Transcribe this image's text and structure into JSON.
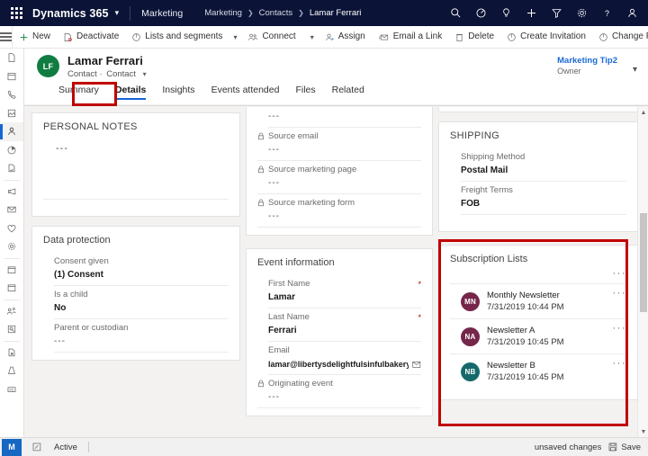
{
  "topbar": {
    "waffle_icon": "waffle-grid-icon",
    "brand": "Dynamics 365",
    "brand_chevron": "chevron-down-icon",
    "app_name": "Marketing",
    "breadcrumbs": [
      {
        "label": "Marketing"
      },
      {
        "label": "Contacts"
      },
      {
        "label": "Lamar Ferrari"
      }
    ],
    "icons": [
      {
        "name": "search-icon"
      },
      {
        "name": "gauge-icon"
      },
      {
        "name": "lightbulb-icon"
      },
      {
        "name": "plus-icon"
      },
      {
        "name": "filter-icon"
      },
      {
        "name": "gear-icon"
      },
      {
        "name": "question-icon"
      },
      {
        "name": "person-icon"
      }
    ]
  },
  "commandbar": {
    "menu_icon": "hamburger-icon",
    "items": [
      {
        "label": "New",
        "icon": "plus-icon"
      },
      {
        "label": "Deactivate",
        "icon": "deactivate-icon"
      },
      {
        "label": "Lists and segments",
        "icon": "lists-icon",
        "chevron": true
      },
      {
        "label": "Connect",
        "icon": "connect-icon",
        "chevron": true,
        "divider_before_chevron": true
      },
      {
        "label": "Assign",
        "icon": "assign-icon"
      },
      {
        "label": "Email a Link",
        "icon": "email-link-icon"
      },
      {
        "label": "Delete",
        "icon": "delete-icon"
      },
      {
        "label": "Create Invitation",
        "icon": "invitation-icon"
      },
      {
        "label": "Change Password",
        "icon": "password-icon"
      }
    ],
    "overflow": "…"
  },
  "rail": {
    "items": [
      {
        "name": "recent-icon"
      },
      {
        "name": "calendar-icon"
      },
      {
        "name": "phone-icon"
      },
      {
        "name": "activity-icon"
      },
      {
        "name": "contacts-icon",
        "selected": true
      },
      {
        "name": "segments-icon"
      },
      {
        "name": "subscription-lists-icon"
      },
      {
        "name": "campaign-icon"
      },
      {
        "name": "email-icon"
      },
      {
        "name": "heart-icon"
      },
      {
        "name": "settings-icon"
      },
      {
        "name": "events-icon"
      },
      {
        "name": "calendar2-icon"
      },
      {
        "name": "social-icon"
      },
      {
        "name": "lead-icon"
      },
      {
        "name": "form-icon"
      },
      {
        "name": "page-icon"
      },
      {
        "name": "keyword-icon"
      }
    ],
    "bottom_badge": "M"
  },
  "record_header": {
    "avatar_initials": "LF",
    "title": "Lamar Ferrari",
    "subtitle_type": "Contact",
    "subtitle_sep": "·",
    "subtitle_entity": "Contact",
    "subtitle_chevron": "chevron-down-icon",
    "owner_name": "Marketing Tip2",
    "owner_label": "Owner",
    "owner_chevron": "chevron-down-icon"
  },
  "tabs": [
    {
      "label": "Summary",
      "active": false
    },
    {
      "label": "Details",
      "active": true
    },
    {
      "label": "Insights",
      "active": false
    },
    {
      "label": "Events attended",
      "active": false
    },
    {
      "label": "Files",
      "active": false
    },
    {
      "label": "Related",
      "active": false
    }
  ],
  "column1": {
    "personal_notes": {
      "title": "PERSONAL NOTES",
      "value": "---"
    },
    "data_protection": {
      "title": "Data protection",
      "fields": [
        {
          "label": "Consent given",
          "value": "(1) Consent"
        },
        {
          "label": "Is a child",
          "value": "No"
        },
        {
          "label": "Parent or custodian",
          "value": "---"
        }
      ]
    }
  },
  "column2": {
    "source_card": {
      "top_value": "---",
      "fields": [
        {
          "label": "Source email",
          "value": "---",
          "locked": true
        },
        {
          "label": "Source marketing page",
          "value": "---",
          "locked": true
        },
        {
          "label": "Source marketing form",
          "value": "---",
          "locked": true
        }
      ]
    },
    "event_information": {
      "title": "Event information",
      "fields": [
        {
          "label": "First Name",
          "value": "Lamar",
          "required": true,
          "locked": false
        },
        {
          "label": "Last Name",
          "value": "Ferrari",
          "required": true,
          "locked": false
        },
        {
          "label": "Email",
          "value": "lamar@libertysdelightfulsinfulbakeryandcaf...",
          "required": false,
          "locked": false,
          "trailing_icon": "email-icon"
        },
        {
          "label": "Originating event",
          "value": "---",
          "required": false,
          "locked": true
        }
      ]
    }
  },
  "column3": {
    "shipping": {
      "title": "SHIPPING",
      "fields": [
        {
          "label": "Shipping Method",
          "value": "Postal Mail"
        },
        {
          "label": "Freight Terms",
          "value": "FOB"
        }
      ]
    },
    "subscription_lists": {
      "title": "Subscription Lists",
      "overflow": "···",
      "items": [
        {
          "initials": "MN",
          "name": "Monthly Newsletter",
          "date": "7/31/2019 10:44 PM",
          "color": "#76264b",
          "overflow": "···"
        },
        {
          "initials": "NA",
          "name": "Newsletter A",
          "date": "7/31/2019 10:45 PM",
          "color": "#76264b",
          "overflow": "···"
        },
        {
          "initials": "NB",
          "name": "Newsletter B",
          "date": "7/31/2019 10:45 PM",
          "color": "#15696b",
          "overflow": "···"
        }
      ]
    }
  },
  "statusbar": {
    "badge": "M",
    "edit_icon": "edit-icon",
    "state": "Active",
    "unsaved": "unsaved changes",
    "save_label": "Save",
    "save_icon": "save-icon"
  },
  "annotations": {
    "accent_red": "#c00000",
    "accent_blue": "#1665d8"
  }
}
